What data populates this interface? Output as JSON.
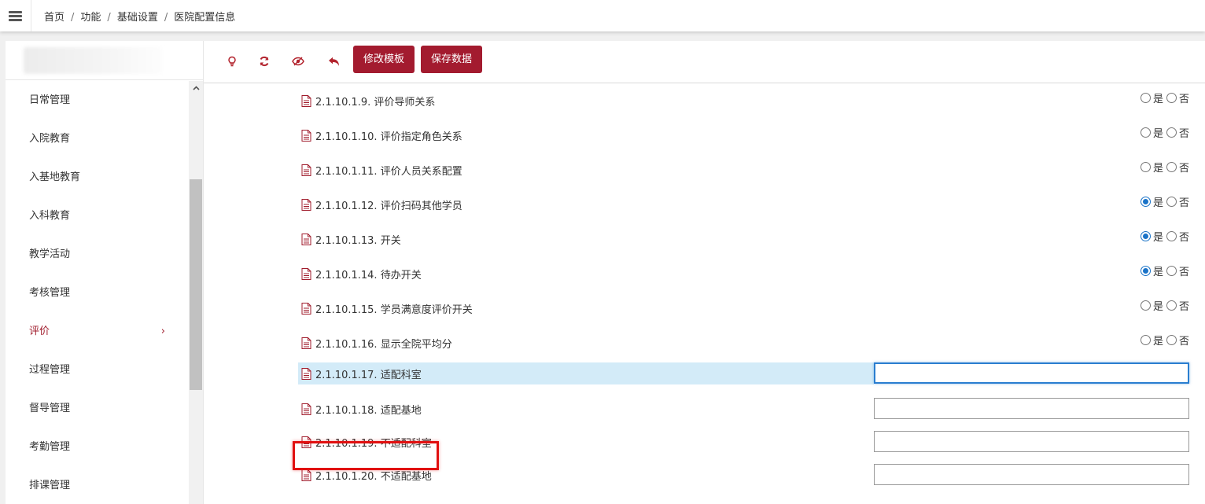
{
  "breadcrumb": {
    "items": [
      "首页",
      "功能",
      "基础设置",
      "医院配置信息"
    ]
  },
  "sidebar": {
    "items": [
      {
        "label": "日常管理"
      },
      {
        "label": "入院教育"
      },
      {
        "label": "入基地教育"
      },
      {
        "label": "入科教育"
      },
      {
        "label": "教学活动"
      },
      {
        "label": "考核管理"
      },
      {
        "label": "评价",
        "active": true,
        "chevron": "›"
      },
      {
        "label": "过程管理"
      },
      {
        "label": "督导管理"
      },
      {
        "label": "考勤管理"
      },
      {
        "label": "排课管理"
      }
    ]
  },
  "toolbar": {
    "icons": [
      "lightbulb-icon",
      "refresh-icon",
      "hide-icon",
      "undo-icon"
    ],
    "edit_template_label": "修改模板",
    "save_data_label": "保存数据"
  },
  "colors": {
    "accent": "#a31b2f",
    "radio_checked": "#1a73c8",
    "highlight_row": "#d3ebf8",
    "callout": "#e11010"
  },
  "config_rows": [
    {
      "label": "2.1.10.1.9. 评价导师关系",
      "type": "radio",
      "value": "none"
    },
    {
      "label": "2.1.10.1.10. 评价指定角色关系",
      "type": "radio",
      "value": "none"
    },
    {
      "label": "2.1.10.1.11. 评价人员关系配置",
      "type": "radio",
      "value": "none"
    },
    {
      "label": "2.1.10.1.12. 评价扫码其他学员",
      "type": "radio",
      "value": "是"
    },
    {
      "label": "2.1.10.1.13. 开关",
      "type": "radio",
      "value": "是"
    },
    {
      "label": "2.1.10.1.14. 待办开关",
      "type": "radio",
      "value": "是"
    },
    {
      "label": "2.1.10.1.15. 学员满意度评价开关",
      "type": "radio",
      "value": "none"
    },
    {
      "label": "2.1.10.1.16. 显示全院平均分",
      "type": "radio",
      "value": "none"
    },
    {
      "label": "2.1.10.1.17. 适配科室",
      "type": "text",
      "value": "",
      "focused": true
    },
    {
      "label": "2.1.10.1.18. 适配基地",
      "type": "text",
      "value": ""
    },
    {
      "label": "2.1.10.1.19. 不适配科室",
      "type": "text",
      "value": "",
      "callout": true
    },
    {
      "label": "2.1.10.1.20. 不适配基地",
      "type": "text",
      "value": ""
    }
  ],
  "radio_options": {
    "yes": "是",
    "no": "否"
  }
}
